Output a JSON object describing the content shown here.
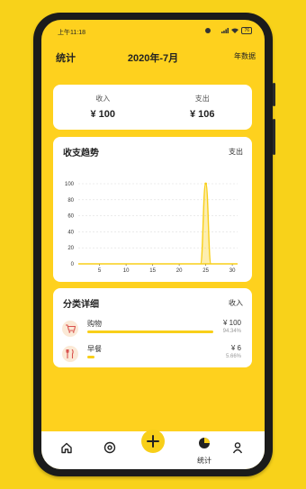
{
  "status_bar": {
    "time": "上午11:18",
    "battery": "76"
  },
  "header": {
    "left": "统计",
    "title": "2020年-7月",
    "right": "年数据"
  },
  "summary": {
    "income_label": "收入",
    "income_value": "¥ 100",
    "expense_label": "支出",
    "expense_value": "¥ 106"
  },
  "trend": {
    "title": "收支趋势",
    "toggle": "支出"
  },
  "chart_data": {
    "type": "area",
    "x_ticks": [
      "5",
      "10",
      "15",
      "20",
      "25",
      "30"
    ],
    "y_ticks": [
      "0",
      "20",
      "40",
      "60",
      "80",
      "100"
    ],
    "ylim": [
      0,
      100
    ],
    "xlim": [
      1,
      31
    ],
    "x": [
      1,
      2,
      3,
      4,
      5,
      6,
      7,
      8,
      9,
      10,
      11,
      12,
      13,
      14,
      15,
      16,
      17,
      18,
      19,
      20,
      21,
      22,
      23,
      24,
      25,
      26,
      27,
      28,
      29,
      30,
      31
    ],
    "values": [
      0,
      0,
      0,
      0,
      0,
      0,
      0,
      0,
      0,
      0,
      0,
      0,
      0,
      0,
      0,
      0,
      0,
      0,
      0,
      0,
      0,
      0,
      0,
      0,
      100,
      0,
      0,
      0,
      0,
      0,
      0
    ]
  },
  "category": {
    "title": "分类详细",
    "toggle": "收入",
    "items": [
      {
        "name": "购物",
        "amount": "¥ 100",
        "percent": "94.34%",
        "fraction": 0.9434,
        "icon": "cart-icon"
      },
      {
        "name": "早餐",
        "amount": "¥ 6",
        "percent": "5.66%",
        "fraction": 0.0566,
        "icon": "cutlery-icon"
      }
    ]
  },
  "tabbar": {
    "stats_label": "统计"
  },
  "colors": {
    "accent": "#f8cf19",
    "background": "#fed11e"
  }
}
